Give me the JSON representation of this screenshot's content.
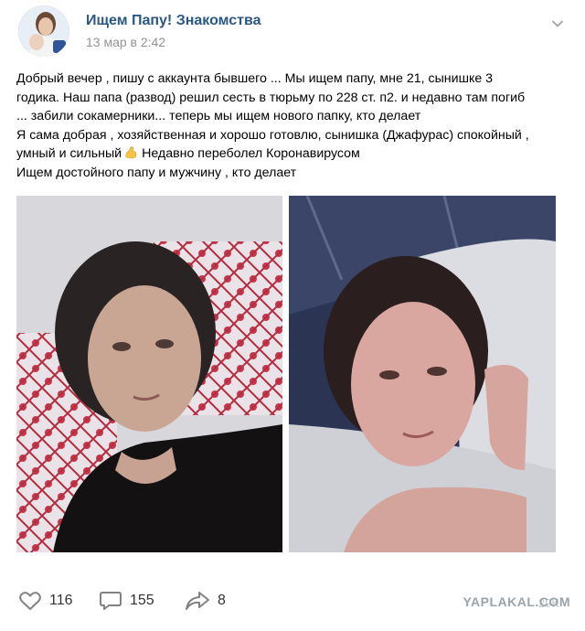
{
  "post": {
    "author": "Ищем Папу! Знакомства",
    "time": "13 мар в 2:42",
    "text_lines": [
      "Добрый вечер , пишу с аккаунта бывшего ... Мы ищем папу, мне 21, сынишке 3",
      "годика. Наш папа (развод) решил сесть в тюрьму по 228 ст. п2. и недавно там погиб",
      "... забили сокамерники... теперь мы ищем нового папку, кто делает",
      "Я сама добрая , хозяйственная и хорошо готовлю, сынишка (Джафурас) спокойный ,",
      "умный и сильный",
      "Недавно переболел Коронавирусом",
      "Ищем достойного папу и мужчину , кто делает"
    ],
    "emoji": "flexed-biceps"
  },
  "actions": {
    "likes": "116",
    "comments": "155",
    "shares": "8"
  },
  "icons": {
    "like": "heart-icon",
    "comment": "comment-icon",
    "share": "share-arrow-icon",
    "menu": "chevron-down-icon"
  },
  "watermark": "YAPLAKAL.COM",
  "views": "29K",
  "colors": {
    "author_link": "#2a5885",
    "meta_gray": "#939393",
    "icon_gray": "#828282"
  }
}
